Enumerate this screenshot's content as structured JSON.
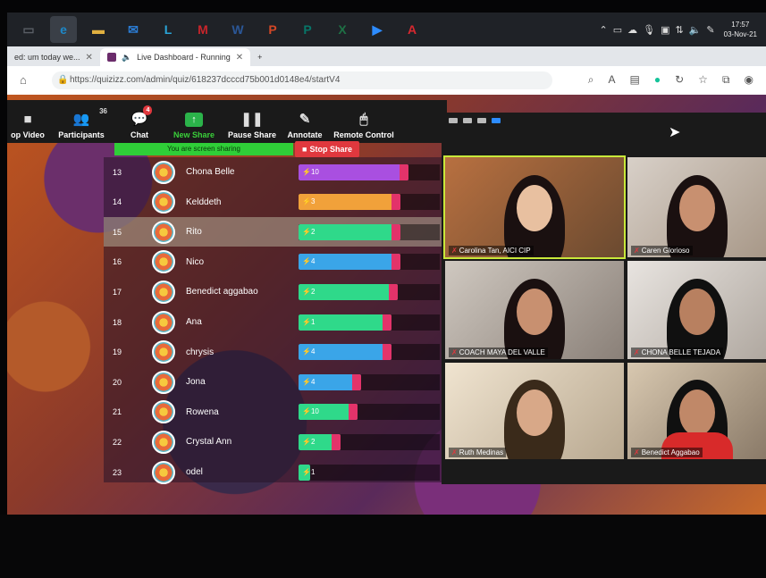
{
  "taskbar": {
    "apps": [
      {
        "icon": "task-view-icon",
        "glyph": "▭",
        "color": "#5a5f66"
      },
      {
        "icon": "edge-icon",
        "glyph": "e",
        "color": "#1e88c8"
      },
      {
        "icon": "file-explorer-icon",
        "glyph": "▬",
        "color": "#e0b040"
      },
      {
        "icon": "mail-icon",
        "glyph": "✉",
        "color": "#2b7cd3"
      },
      {
        "icon": "lens-app-icon",
        "glyph": "L",
        "color": "#2aa5d8"
      },
      {
        "icon": "mcafee-icon",
        "glyph": "M",
        "color": "#c8252b"
      },
      {
        "icon": "word-icon",
        "glyph": "W",
        "color": "#2b5797"
      },
      {
        "icon": "powerpoint-icon",
        "glyph": "P",
        "color": "#d24726"
      },
      {
        "icon": "publisher-icon",
        "glyph": "P",
        "color": "#077568"
      },
      {
        "icon": "excel-icon",
        "glyph": "X",
        "color": "#1e7145"
      },
      {
        "icon": "zoom-icon",
        "glyph": "▶",
        "color": "#2d8cff"
      },
      {
        "icon": "acrobat-icon",
        "glyph": "A",
        "color": "#d7282f"
      }
    ],
    "time": "17:57",
    "date": "03-Nov-21"
  },
  "browser": {
    "tab1": "ed: um today we...",
    "tab2": "Live Dashboard - Running",
    "new_tab": "+",
    "url": "https://quizizz.com/admin/quiz/618237dcccd75b001d0148e4/startV4"
  },
  "zoom_toolbar": {
    "items": [
      {
        "label": "op Video",
        "icon": "■",
        "name": "stop-video-button"
      },
      {
        "label": "Participants",
        "icon": "👥",
        "name": "participants-button",
        "count": "36"
      },
      {
        "label": "Chat",
        "icon": "💬",
        "name": "chat-button",
        "badge": "4"
      },
      {
        "label": "New Share",
        "icon": "↑",
        "name": "new-share-button",
        "green": true
      },
      {
        "label": "Pause Share",
        "icon": "❚❚",
        "name": "pause-share-button"
      },
      {
        "label": "Annotate",
        "icon": "✎",
        "name": "annotate-button"
      },
      {
        "label": "Remote Control",
        "icon": "🖱",
        "name": "remote-control-button"
      }
    ],
    "sharing_banner": "You are screen sharing",
    "stop_share": "Stop Share"
  },
  "leaderboard": [
    {
      "rank": "13",
      "name": "Chona Belle",
      "score": "10",
      "fill": 0.78,
      "color": "#a94fe0"
    },
    {
      "rank": "14",
      "name": "Kelddeth",
      "score": "3",
      "fill": 0.72,
      "color": "#f1a13a"
    },
    {
      "rank": "15",
      "name": "Rito",
      "score": "2",
      "fill": 0.72,
      "color": "#2fd98a",
      "highlight": true
    },
    {
      "rank": "16",
      "name": "Nico",
      "score": "4",
      "fill": 0.72,
      "color": "#3aa5e8"
    },
    {
      "rank": "17",
      "name": "Benedict aggabao",
      "score": "2",
      "fill": 0.7,
      "color": "#2fd98a"
    },
    {
      "rank": "18",
      "name": "Ana",
      "score": "1",
      "fill": 0.66,
      "color": "#2fd98a"
    },
    {
      "rank": "19",
      "name": "chrysis",
      "score": "4",
      "fill": 0.66,
      "color": "#3aa5e8"
    },
    {
      "rank": "20",
      "name": "Jona",
      "score": "4",
      "fill": 0.44,
      "color": "#3aa5e8"
    },
    {
      "rank": "21",
      "name": "Rowena",
      "score": "10",
      "fill": 0.42,
      "color": "#2fd98a"
    },
    {
      "rank": "22",
      "name": "Crystal Ann",
      "score": "2",
      "fill": 0.3,
      "color": "#2fd98a"
    },
    {
      "rank": "23",
      "name": "odel",
      "score": "1",
      "fill": 0.08,
      "color": "#2fd98a"
    }
  ],
  "gallery": [
    {
      "name": "Carolina Tan, AICI CIP",
      "speaker": true
    },
    {
      "name": "Caren Glorioso"
    },
    {
      "name": "COACH MAYA DEL VALLE"
    },
    {
      "name": "CHONA BELLE TEJADA"
    },
    {
      "name": "Ruth Medinas"
    },
    {
      "name": "Benedict Aggabao"
    }
  ],
  "colors": {
    "accent_green": "#2fce38",
    "stop_red": "#e0383e"
  }
}
